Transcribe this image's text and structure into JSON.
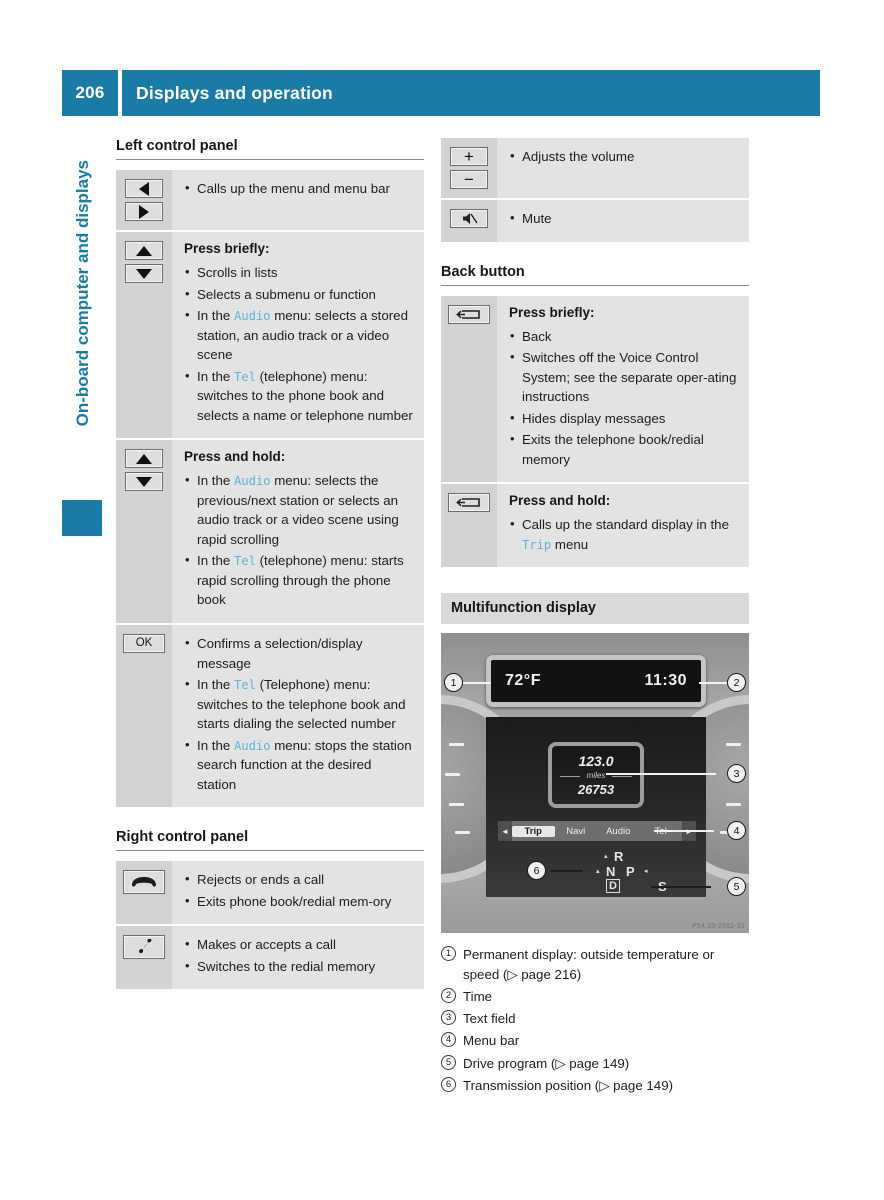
{
  "header": {
    "page_number": "206",
    "title": "Displays and operation"
  },
  "side_tab": {
    "label": "On-board computer and displays"
  },
  "left_column": {
    "sections": [
      {
        "heading": "Left control panel",
        "rows": [
          {
            "icons": [
              "triangle-left",
              "triangle-right"
            ],
            "title": "",
            "bullets": [
              [
                {
                  "t": "Calls up the menu and menu bar"
                }
              ]
            ]
          },
          {
            "icons": [
              "triangle-up",
              "triangle-down"
            ],
            "title": "Press briefly:",
            "bullets": [
              [
                {
                  "t": "Scrolls in lists"
                }
              ],
              [
                {
                  "t": "Selects a submenu or function"
                }
              ],
              [
                {
                  "t": "In the "
                },
                {
                  "t": "Audio",
                  "s": "mono"
                },
                {
                  "t": " menu: selects a stored station, an audio track or a video scene"
                }
              ],
              [
                {
                  "t": "In the "
                },
                {
                  "t": "Tel",
                  "s": "mono"
                },
                {
                  "t": " (telephone) menu: switches to the phone book and selects a name or telephone number"
                }
              ]
            ]
          },
          {
            "icons": [
              "triangle-up",
              "triangle-down"
            ],
            "title": "Press and hold:",
            "bullets": [
              [
                {
                  "t": "In the "
                },
                {
                  "t": "Audio",
                  "s": "mono"
                },
                {
                  "t": " menu: selects the previous/next station or selects an audio track or a video scene using rapid scrolling"
                }
              ],
              [
                {
                  "t": "In the "
                },
                {
                  "t": "Tel",
                  "s": "mono"
                },
                {
                  "t": " (telephone) menu: starts rapid scrolling through the phone book"
                }
              ]
            ]
          },
          {
            "icons": [
              "ok-key"
            ],
            "title": "",
            "bullets": [
              [
                {
                  "t": "Confirms a selection/display message"
                }
              ],
              [
                {
                  "t": "In the "
                },
                {
                  "t": "Tel",
                  "s": "mono"
                },
                {
                  "t": " (Telephone) menu: switches to the telephone book and starts dialing the selected number"
                }
              ],
              [
                {
                  "t": "In the "
                },
                {
                  "t": "Audio",
                  "s": "mono"
                },
                {
                  "t": " menu: stops the station search function at the desired station"
                }
              ]
            ]
          }
        ]
      },
      {
        "heading": "Right control panel",
        "rows": [
          {
            "icons": [
              "phone-hangup"
            ],
            "title": "",
            "bullets": [
              [
                {
                  "t": "Rejects or ends a call"
                }
              ],
              [
                {
                  "t": "Exits phone book/redial mem‐ory"
                }
              ]
            ]
          },
          {
            "icons": [
              "phone-call"
            ],
            "title": "",
            "bullets": [
              [
                {
                  "t": "Makes or accepts a call"
                }
              ],
              [
                {
                  "t": "Switches to the redial memory"
                }
              ]
            ]
          }
        ]
      }
    ]
  },
  "right_column": {
    "top_rows": [
      {
        "icons": [
          "plus-key",
          "minus-key"
        ],
        "title": "",
        "bullets": [
          [
            {
              "t": "Adjusts the volume"
            }
          ]
        ]
      },
      {
        "icons": [
          "mute-key"
        ],
        "title": "",
        "bullets": [
          [
            {
              "t": "Mute"
            }
          ]
        ]
      }
    ],
    "back_button": {
      "heading": "Back button",
      "rows": [
        {
          "icons": [
            "back-key"
          ],
          "title": "Press briefly:",
          "bullets": [
            [
              {
                "t": "Back"
              }
            ],
            [
              {
                "t": "Switches off the Voice Control System; see the separate oper‐ating instructions"
              }
            ],
            [
              {
                "t": "Hides display messages"
              }
            ],
            [
              {
                "t": "Exits the telephone book/redial memory"
              }
            ]
          ]
        },
        {
          "icons": [
            "back-key"
          ],
          "title": "Press and hold:",
          "bullets": [
            [
              {
                "t": "Calls up the standard display in the "
              },
              {
                "t": "Trip",
                "s": "mono"
              },
              {
                "t": " menu"
              }
            ]
          ]
        }
      ]
    },
    "multifunction_display": {
      "banner": "Multifunction display",
      "illustration": {
        "outside_temperature": "72°F",
        "time": "11:30",
        "trip_distance": "123.0",
        "distance_unit": "miles",
        "odometer": "26753",
        "menu_items": [
          "Trip",
          "Navi",
          "Audio",
          "Tel"
        ],
        "menu_active": "Trip",
        "menu_arrow_left": "◄",
        "menu_arrow_right": "►",
        "gear_positions": [
          "R",
          "N",
          "P",
          "D"
        ],
        "drive_program": "S",
        "callouts": [
          "1",
          "2",
          "3",
          "4",
          "5",
          "6"
        ],
        "watermark": "P54.33-2661-31"
      },
      "captions": [
        {
          "num": "1",
          "text": "Permanent display: outside temperature or speed (▷ page 216)"
        },
        {
          "num": "2",
          "text": "Time"
        },
        {
          "num": "3",
          "text": "Text field"
        },
        {
          "num": "4",
          "text": "Menu bar"
        },
        {
          "num": "5",
          "text": "Drive program (▷ page 149)"
        },
        {
          "num": "6",
          "text": "Transmission position (▷ page 149)"
        }
      ]
    }
  },
  "colors": {
    "brand_blue": "#1a7ba6",
    "mono_blue": "#5fb4d8",
    "icon_cell": "#d2d2d2",
    "body_cell": "#e3e3e3",
    "banner_gray": "#d9d9d9"
  }
}
